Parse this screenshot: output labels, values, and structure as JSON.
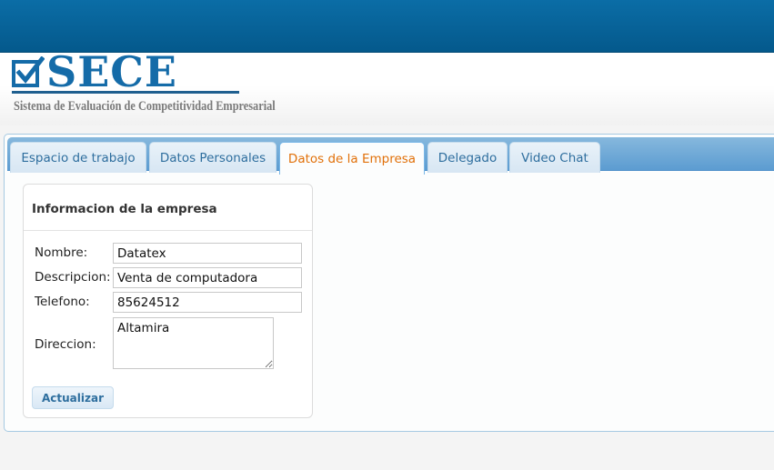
{
  "header": {
    "logo_text": "SECE",
    "logo_subtitle": "Sistema de Evaluación de Competitividad Empresarial",
    "brand_color": "#146ba8"
  },
  "tabs": [
    {
      "label": "Espacio de trabajo",
      "active": false
    },
    {
      "label": "Datos Personales",
      "active": false
    },
    {
      "label": "Datos de la Empresa",
      "active": true
    },
    {
      "label": "Delegado",
      "active": false
    },
    {
      "label": "Video Chat",
      "active": false
    }
  ],
  "company_form": {
    "title": "Informacion de la empresa",
    "name_label": "Nombre:",
    "name_value": "Datatex",
    "description_label": "Descripcion:",
    "description_value": "Venta de computadora",
    "phone_label": "Telefono:",
    "phone_value": "85624512",
    "address_label": "Direccion:",
    "address_value": "Altamira",
    "submit_label": "Actualizar"
  }
}
